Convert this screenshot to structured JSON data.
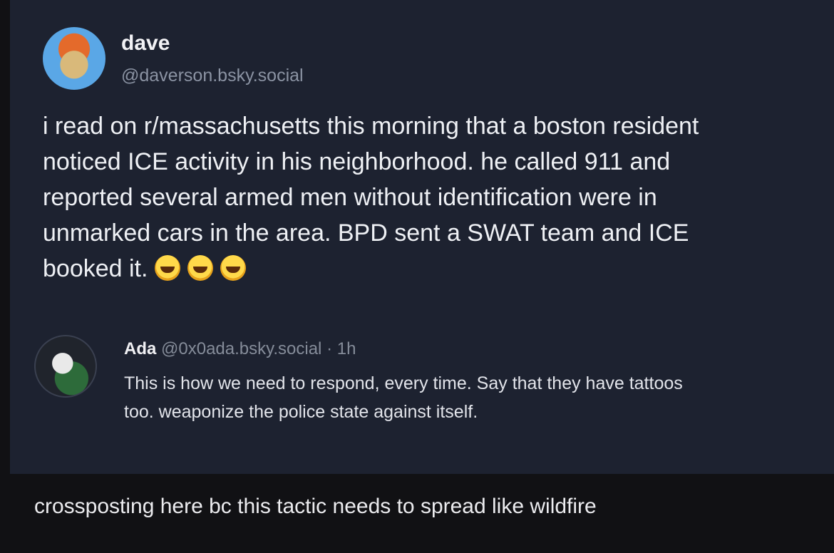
{
  "post": {
    "display_name": "dave",
    "handle": "@daverson.bsky.social",
    "lines": [
      "i read on r/massachusetts this morning that a boston resident",
      "noticed ICE activity in his neighborhood. he called 911 and",
      "reported several armed men without identification were in",
      "unmarked cars in the area. BPD sent a SWAT team and ICE",
      "booked it."
    ],
    "emoji_icon": "rolling-on-floor-laughing-icon"
  },
  "reply": {
    "display_name": "Ada",
    "handle": "@0x0ada.bsky.social",
    "separator": "·",
    "time": "1h",
    "lines": [
      "This is how we need to respond, every time. Say that they have tattoos",
      "too. weaponize the police state against itself."
    ]
  },
  "caption": "crossposting here bc this tactic needs to spread like wildfire"
}
